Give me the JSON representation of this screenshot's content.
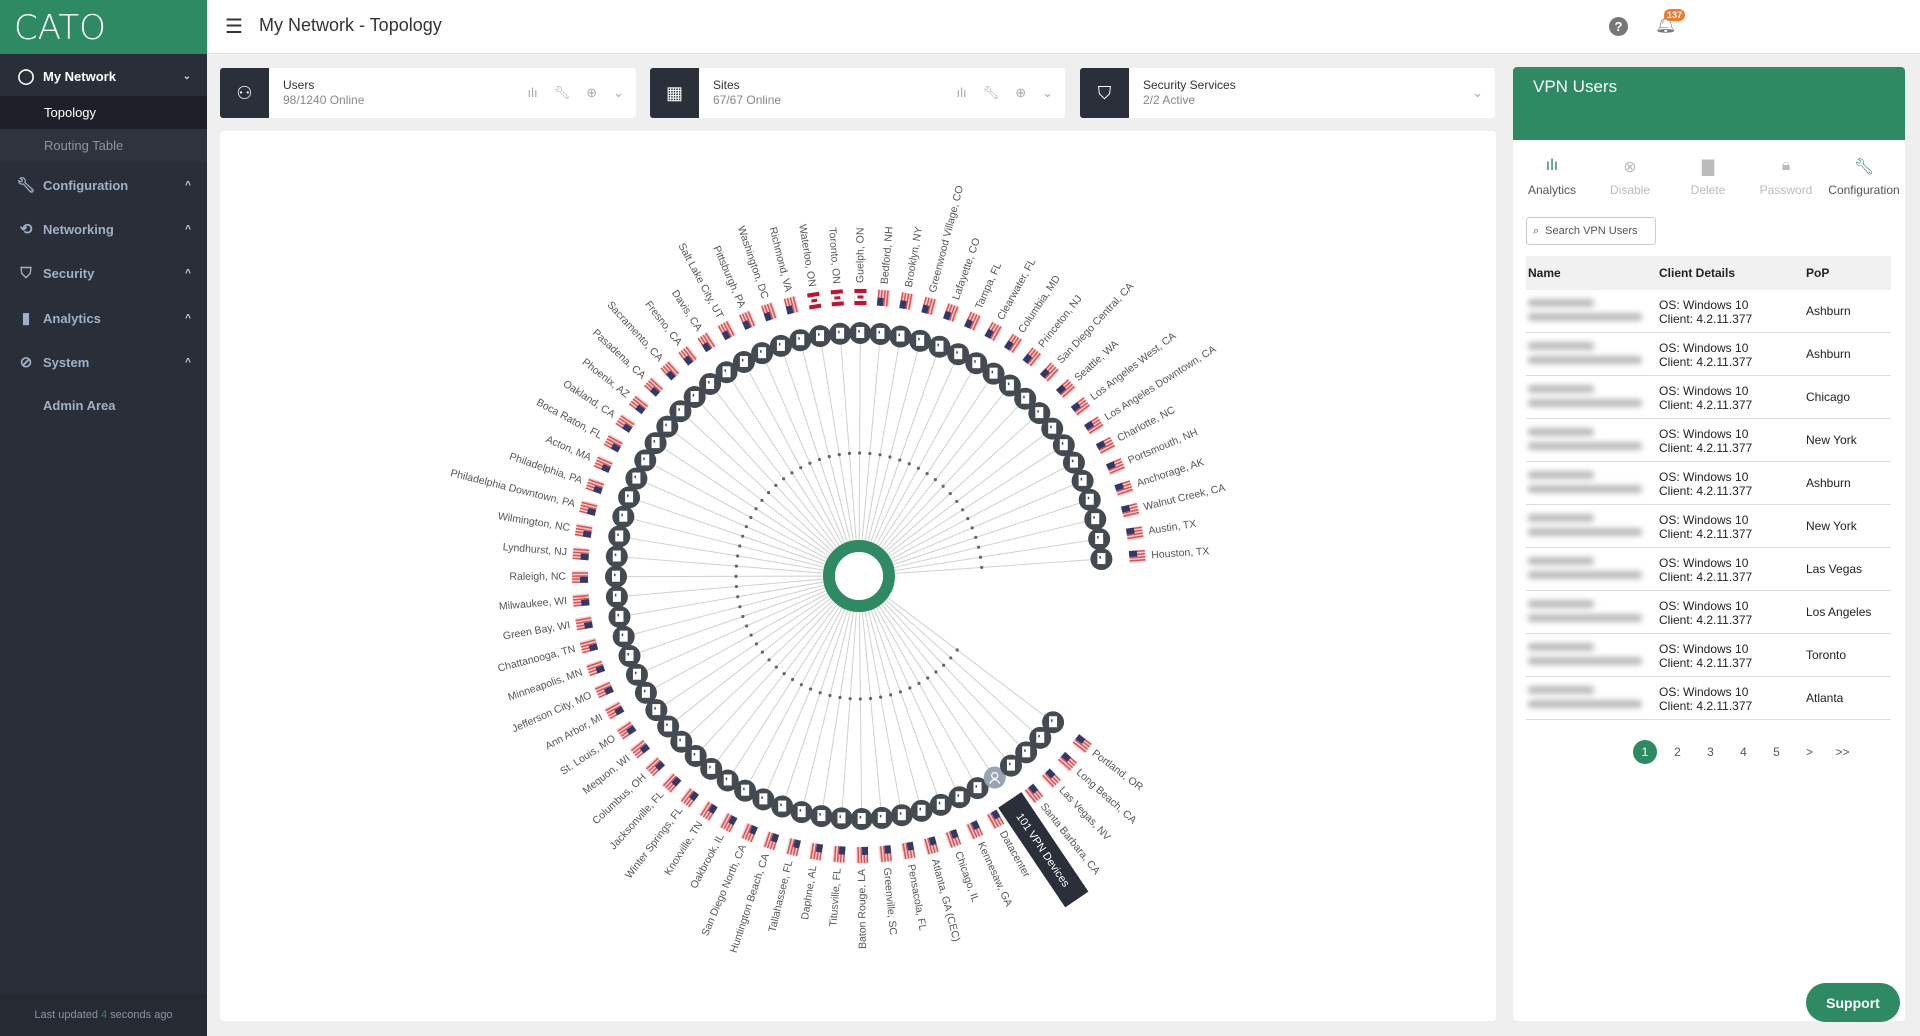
{
  "app": {
    "logo": "CATO",
    "page_title": "My Network - Topology"
  },
  "sidebar": {
    "my_network": "My Network",
    "topology": "Topology",
    "routing_table": "Routing Table",
    "items": [
      {
        "label": "Configuration",
        "icon": "wrench-icon"
      },
      {
        "label": "Networking",
        "icon": "networking-icon"
      },
      {
        "label": "Security",
        "icon": "shield-icon"
      },
      {
        "label": "Analytics",
        "icon": "bar-chart-icon"
      },
      {
        "label": "System",
        "icon": "system-icon"
      }
    ],
    "admin_area": "Admin Area",
    "last_updated_prefix": "Last updated",
    "last_updated_value": "4",
    "last_updated_suffix": "seconds ago"
  },
  "header": {
    "notifications_count": "137"
  },
  "cards": [
    {
      "title": "Users",
      "status": "98/1240 Online"
    },
    {
      "title": "Sites",
      "status": "67/67 Online"
    },
    {
      "title": "Security Services",
      "status": "2/2 Active"
    }
  ],
  "topology": {
    "vpn_tooltip": "101 VPN Devices",
    "colors": {
      "hub": "#2e8a62",
      "node": "#444a52"
    },
    "sites": [
      {
        "label": "Houston, TX",
        "flag": "us"
      },
      {
        "label": "Austin, TX",
        "flag": "us"
      },
      {
        "label": "Walnut Creek, CA",
        "flag": "us"
      },
      {
        "label": "Anchorage, AK",
        "flag": "us"
      },
      {
        "label": "Portsmouth, NH",
        "flag": "us"
      },
      {
        "label": "Charlotte, NC",
        "flag": "us"
      },
      {
        "label": "Los Angeles Downtown, CA",
        "flag": "us"
      },
      {
        "label": "Los Angeles West, CA",
        "flag": "us"
      },
      {
        "label": "Seattle, WA",
        "flag": "us"
      },
      {
        "label": "San Diego Central, CA",
        "flag": "us"
      },
      {
        "label": "Princeton, NJ",
        "flag": "us"
      },
      {
        "label": "Columbia, MD",
        "flag": "us"
      },
      {
        "label": "Clearwater, FL",
        "flag": "us"
      },
      {
        "label": "Tampa, FL",
        "flag": "us"
      },
      {
        "label": "Lafayette, CO",
        "flag": "us"
      },
      {
        "label": "Greenwood Village, CO",
        "flag": "us"
      },
      {
        "label": "Brooklyn, NY",
        "flag": "us"
      },
      {
        "label": "Bedford, NH",
        "flag": "us"
      },
      {
        "label": "Guelph, ON",
        "flag": "ca"
      },
      {
        "label": "Toronto, ON",
        "flag": "ca"
      },
      {
        "label": "Waterloo, ON",
        "flag": "ca"
      },
      {
        "label": "Richmond, VA",
        "flag": "us"
      },
      {
        "label": "Washington, DC",
        "flag": "us"
      },
      {
        "label": "Pittsburgh, PA",
        "flag": "us"
      },
      {
        "label": "Salt Lake City, UT",
        "flag": "us"
      },
      {
        "label": "Davis, CA",
        "flag": "us"
      },
      {
        "label": "Fresno, CA",
        "flag": "us"
      },
      {
        "label": "Sacramento, CA",
        "flag": "us"
      },
      {
        "label": "Pasadena, CA",
        "flag": "us"
      },
      {
        "label": "Phoenix, AZ",
        "flag": "us"
      },
      {
        "label": "Oakland, CA",
        "flag": "us"
      },
      {
        "label": "Boca Raton, FL",
        "flag": "us"
      },
      {
        "label": "Acton, MA",
        "flag": "us"
      },
      {
        "label": "Philadelphia, PA",
        "flag": "us"
      },
      {
        "label": "Philadelphia Downtown, PA",
        "flag": "us"
      },
      {
        "label": "Wilmington, NC",
        "flag": "us"
      },
      {
        "label": "Lyndhurst, NJ",
        "flag": "us"
      },
      {
        "label": "Raleigh, NC",
        "flag": "us"
      },
      {
        "label": "Milwaukee, WI",
        "flag": "us"
      },
      {
        "label": "Green Bay, WI",
        "flag": "us"
      },
      {
        "label": "Chattanooga, TN",
        "flag": "us"
      },
      {
        "label": "Minneapolis, MN",
        "flag": "us"
      },
      {
        "label": "Jefferson City, MO",
        "flag": "us"
      },
      {
        "label": "Ann Arbor, MI",
        "flag": "us"
      },
      {
        "label": "St. Louis, MO",
        "flag": "us"
      },
      {
        "label": "Mequon, WI",
        "flag": "us"
      },
      {
        "label": "Columbus, OH",
        "flag": "us"
      },
      {
        "label": "Jacksonville, FL",
        "flag": "us"
      },
      {
        "label": "Winter Springs, FL",
        "flag": "us"
      },
      {
        "label": "Knoxville, TN",
        "flag": "us"
      },
      {
        "label": "Oakbrook, IL",
        "flag": "us"
      },
      {
        "label": "San Diego North, CA",
        "flag": "us"
      },
      {
        "label": "Huntington Beach, CA",
        "flag": "us"
      },
      {
        "label": "Tallahassee, FL",
        "flag": "us"
      },
      {
        "label": "Daphne, AL",
        "flag": "us"
      },
      {
        "label": "Titusville, FL",
        "flag": "us"
      },
      {
        "label": "Baton Rouge, LA",
        "flag": "us"
      },
      {
        "label": "Greenville, SC",
        "flag": "us"
      },
      {
        "label": "Pensacola, FL",
        "flag": "us"
      },
      {
        "label": "Atlanta, GA (CEC)",
        "flag": "us"
      },
      {
        "label": "Chicago, IL",
        "flag": "us"
      },
      {
        "label": "Kennesaw, GA",
        "flag": "us"
      },
      {
        "label": "Datacenter",
        "flag": "us"
      },
      {
        "label": "Santa Barbara, CA",
        "flag": "us"
      },
      {
        "label": "Las Vegas, NV",
        "flag": "us"
      },
      {
        "label": "Long Beach, CA",
        "flag": "us"
      },
      {
        "label": "Portland, OR",
        "flag": "us"
      }
    ]
  },
  "vpn_panel": {
    "title": "VPN Users",
    "actions": [
      {
        "label": "Analytics",
        "icon": "analytics-icon",
        "enabled": true
      },
      {
        "label": "Disable",
        "icon": "disable-icon",
        "enabled": false
      },
      {
        "label": "Delete",
        "icon": "trash-icon",
        "enabled": false
      },
      {
        "label": "Password",
        "icon": "lock-icon",
        "enabled": false
      },
      {
        "label": "Configuration",
        "icon": "wrench-icon",
        "enabled": true
      }
    ],
    "search_placeholder": "Search VPN Users",
    "columns": [
      "Name",
      "Client Details",
      "PoP"
    ],
    "rows": [
      {
        "os": "OS: Windows 10",
        "client": "Client: 4.2.11.377",
        "pop": "Ashburn"
      },
      {
        "os": "OS: Windows 10",
        "client": "Client: 4.2.11.377",
        "pop": "Ashburn"
      },
      {
        "os": "OS: Windows 10",
        "client": "Client: 4.2.11.377",
        "pop": "Chicago"
      },
      {
        "os": "OS: Windows 10",
        "client": "Client: 4.2.11.377",
        "pop": "New York"
      },
      {
        "os": "OS: Windows 10",
        "client": "Client: 4.2.11.377",
        "pop": "Ashburn"
      },
      {
        "os": "OS: Windows 10",
        "client": "Client: 4.2.11.377",
        "pop": "New York"
      },
      {
        "os": "OS: Windows 10",
        "client": "Client: 4.2.11.377",
        "pop": "Las Vegas"
      },
      {
        "os": "OS: Windows 10",
        "client": "Client: 4.2.11.377",
        "pop": "Los Angeles"
      },
      {
        "os": "OS: Windows 10",
        "client": "Client: 4.2.11.377",
        "pop": "Toronto"
      },
      {
        "os": "OS: Windows 10",
        "client": "Client: 4.2.11.377",
        "pop": "Atlanta"
      }
    ],
    "pagination": [
      "1",
      "2",
      "3",
      "4",
      "5",
      ">",
      ">>"
    ],
    "current_page": "1"
  },
  "support_label": "Support"
}
